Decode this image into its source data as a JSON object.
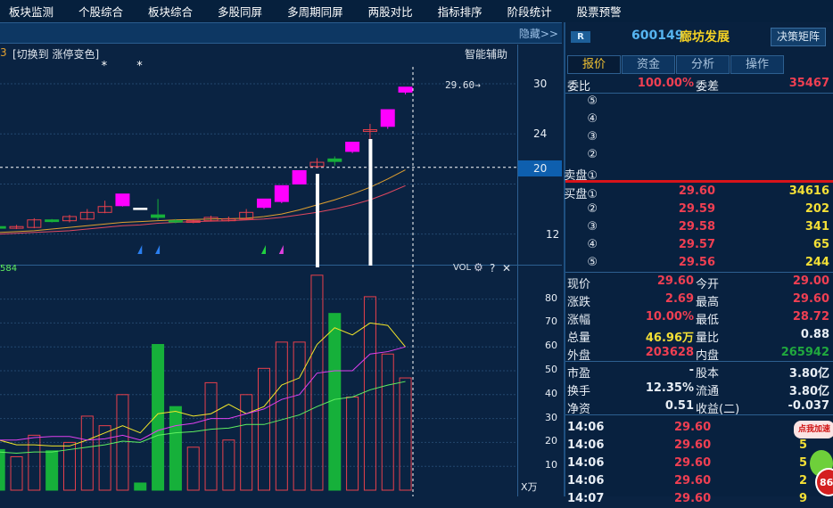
{
  "menu": [
    "板块监测",
    "个股综合",
    "板块综合",
    "多股同屏",
    "多周期同屏",
    "两股对比",
    "指标排序",
    "阶段统计",
    "股票预警"
  ],
  "subbar": {
    "hide": "隐藏>>"
  },
  "chart": {
    "switch_label": "[切换到 涨停变色]",
    "smart_label": "智能辅助",
    "left_fragment": "3",
    "vol_left_fragment": "584",
    "last_price_label": "29.60→",
    "vol_label": "VOL",
    "vol_help": "?",
    "vol_close": "✕",
    "vol_unit": "X万",
    "price_ticks": [
      "30",
      "24",
      "20",
      "12"
    ],
    "vol_ticks": [
      "80",
      "70",
      "60",
      "50",
      "40",
      "30",
      "20",
      "10"
    ],
    "colors": {
      "up": "#e8404c",
      "down": "#16b03a",
      "limit": "#ff00ff",
      "ma_a": "#e0a030",
      "ma_b": "#e04860",
      "vma_a": "#f2e62a",
      "vma_b": "#e040f0",
      "vma_c": "#60f060"
    }
  },
  "chart_data": {
    "type": "candlestick",
    "price_range": [
      10,
      32
    ],
    "candles": [
      {
        "o": 12.9,
        "h": 13.0,
        "l": 12.6,
        "c": 12.7
      },
      {
        "o": 12.7,
        "h": 13.1,
        "l": 12.6,
        "c": 12.9
      },
      {
        "o": 12.8,
        "h": 13.9,
        "l": 12.7,
        "c": 13.7
      },
      {
        "o": 13.7,
        "h": 13.8,
        "l": 13.4,
        "c": 13.5
      },
      {
        "o": 13.6,
        "h": 14.3,
        "l": 13.4,
        "c": 14.1
      },
      {
        "o": 13.8,
        "h": 15.0,
        "l": 13.7,
        "c": 14.6
      },
      {
        "o": 14.6,
        "h": 16.0,
        "l": 14.5,
        "c": 15.3
      },
      {
        "o": 15.4,
        "h": 16.8,
        "l": 15.3,
        "c": 16.8,
        "limit": true
      },
      {
        "o": 15.1,
        "h": 15.1,
        "l": 15.1,
        "c": 15.1,
        "flat": true
      },
      {
        "o": 14.3,
        "h": 16.2,
        "l": 13.7,
        "c": 14.0
      },
      {
        "o": 13.6,
        "h": 13.8,
        "l": 13.3,
        "c": 13.5
      },
      {
        "o": 13.4,
        "h": 13.7,
        "l": 13.3,
        "c": 13.6
      },
      {
        "o": 13.6,
        "h": 14.2,
        "l": 13.5,
        "c": 14.0
      },
      {
        "o": 13.6,
        "h": 14.1,
        "l": 13.5,
        "c": 13.8
      },
      {
        "o": 13.8,
        "h": 15.0,
        "l": 13.7,
        "c": 14.6
      },
      {
        "o": 15.2,
        "h": 16.2,
        "l": 15.0,
        "c": 16.2,
        "limit": true
      },
      {
        "o": 15.9,
        "h": 17.8,
        "l": 15.7,
        "c": 17.8,
        "limit": true
      },
      {
        "o": 18.0,
        "h": 19.6,
        "l": 18.0,
        "c": 19.6,
        "limit": true
      },
      {
        "o": 20.1,
        "h": 21.1,
        "l": 19.9,
        "c": 20.6
      },
      {
        "o": 21.0,
        "h": 21.3,
        "l": 20.2,
        "c": 20.7
      },
      {
        "o": 21.9,
        "h": 23.0,
        "l": 21.7,
        "c": 23.0,
        "limit": true
      },
      {
        "o": 24.3,
        "h": 25.2,
        "l": 23.3,
        "c": 24.5
      },
      {
        "o": 24.9,
        "h": 26.9,
        "l": 24.6,
        "c": 26.9,
        "limit": true
      },
      {
        "o": 29.0,
        "h": 29.6,
        "l": 28.72,
        "c": 29.6,
        "limit": true
      }
    ],
    "ma_a": [
      12.2,
      12.3,
      12.4,
      12.6,
      12.8,
      13.0,
      13.2,
      13.4,
      13.5,
      13.6,
      13.7,
      13.75,
      13.8,
      13.85,
      13.9,
      14.1,
      14.4,
      14.9,
      15.5,
      16.1,
      16.8,
      17.6,
      18.6,
      19.7
    ],
    "ma_b": [
      12.0,
      12.1,
      12.2,
      12.3,
      12.4,
      12.6,
      12.8,
      13.0,
      13.1,
      13.3,
      13.4,
      13.5,
      13.55,
      13.6,
      13.7,
      13.8,
      14.0,
      14.3,
      14.6,
      15.0,
      15.5,
      16.1,
      16.9,
      17.8
    ],
    "volume_unit": "万",
    "volume_range": [
      0,
      90
    ],
    "volume": [
      17,
      14,
      23,
      16.5,
      20,
      31,
      27,
      40,
      3,
      61,
      35,
      18,
      45,
      21,
      40,
      51,
      62,
      62,
      90,
      74,
      39,
      81,
      57,
      47
    ],
    "volume_down": [
      true,
      false,
      false,
      true,
      false,
      false,
      false,
      false,
      true,
      true,
      true,
      false,
      false,
      false,
      false,
      false,
      false,
      false,
      false,
      true,
      false,
      false,
      false,
      false
    ],
    "vma_a": [
      21,
      19,
      19,
      18.5,
      18.5,
      21,
      24,
      27,
      24,
      32,
      33,
      31,
      32,
      36,
      32,
      35,
      44,
      47,
      61,
      68,
      65,
      70,
      69,
      60
    ],
    "vma_b": [
      21,
      21,
      22,
      22.5,
      22.5,
      21,
      21.5,
      23,
      21,
      25,
      27,
      28,
      30,
      30,
      32,
      34,
      38,
      40,
      49,
      50,
      50,
      57,
      58,
      60
    ],
    "vma_c": [
      16,
      15.5,
      16,
      16,
      17,
      18,
      19,
      20.5,
      20,
      23,
      24,
      24.5,
      25.5,
      26,
      27.5,
      27.5,
      29.5,
      31.5,
      35,
      38,
      39,
      42,
      44,
      45.5
    ],
    "signals": [
      {
        "i": 8,
        "color": "#2a7ff0"
      },
      {
        "i": 9,
        "color": "#2a7ff0"
      },
      {
        "i": 15,
        "color": "#20d040"
      },
      {
        "i": 16,
        "color": "#e040e0"
      }
    ],
    "stars": [
      6,
      8
    ],
    "markers": [
      18,
      21
    ],
    "crosshair_price": 20
  },
  "quote": {
    "badge": "R",
    "code": "600149",
    "name": "廊坊发展",
    "decision_btn": "决策矩阵",
    "tabs": [
      "报价",
      "资金",
      "分析",
      "操作"
    ],
    "weibi_label": "委比",
    "weibi": "100.00%",
    "weicha_label": "委差",
    "weicha": "35467",
    "sell": [
      {
        "label": "⑤"
      },
      {
        "label": "④"
      },
      {
        "label": "③"
      },
      {
        "label": "②"
      },
      {
        "label": "卖盘①"
      }
    ],
    "buy": [
      {
        "label": "买盘①",
        "price": "29.60",
        "vol": "34616"
      },
      {
        "label": "②",
        "price": "29.59",
        "vol": "202"
      },
      {
        "label": "③",
        "price": "29.58",
        "vol": "341"
      },
      {
        "label": "④",
        "price": "29.57",
        "vol": "65"
      },
      {
        "label": "⑤",
        "price": "29.56",
        "vol": "244"
      }
    ],
    "stats": [
      {
        "l1": "现价",
        "v1": "29.60",
        "c1": "red",
        "l2": "今开",
        "v2": "29.00",
        "c2": "red"
      },
      {
        "l1": "涨跌",
        "v1": "2.69",
        "c1": "red",
        "l2": "最高",
        "v2": "29.60",
        "c2": "red"
      },
      {
        "l1": "涨幅",
        "v1": "10.00%",
        "c1": "red",
        "l2": "最低",
        "v2": "28.72",
        "c2": "red"
      },
      {
        "l1": "总量",
        "v1": "46.96万",
        "c1": "yel",
        "l2": "量比",
        "v2": "0.88",
        "c2": "wht"
      },
      {
        "l1": "外盘",
        "v1": "203628",
        "c1": "red",
        "l2": "内盘",
        "v2": "265942",
        "c2": "grn"
      }
    ],
    "stats2": [
      {
        "l1": "市盈",
        "v1": "-",
        "l2": "股本",
        "v2": "3.80亿"
      },
      {
        "l1": "换手",
        "v1": "12.35%",
        "l2": "流通",
        "v2": "3.80亿"
      },
      {
        "l1": "净资",
        "v1": "0.51",
        "l2": "收益(二)",
        "v2": "-0.037"
      }
    ],
    "ticks": [
      {
        "time": "14:06",
        "price": "29.60",
        "vol": ""
      },
      {
        "time": "14:06",
        "price": "29.60",
        "vol": "5"
      },
      {
        "time": "14:06",
        "price": "29.60",
        "vol": "5"
      },
      {
        "time": "14:06",
        "price": "29.60",
        "vol": "2"
      },
      {
        "time": "14:07",
        "price": "29.60",
        "vol": "9"
      }
    ],
    "ad": {
      "bubble": "点我加速",
      "badge": "86"
    }
  }
}
